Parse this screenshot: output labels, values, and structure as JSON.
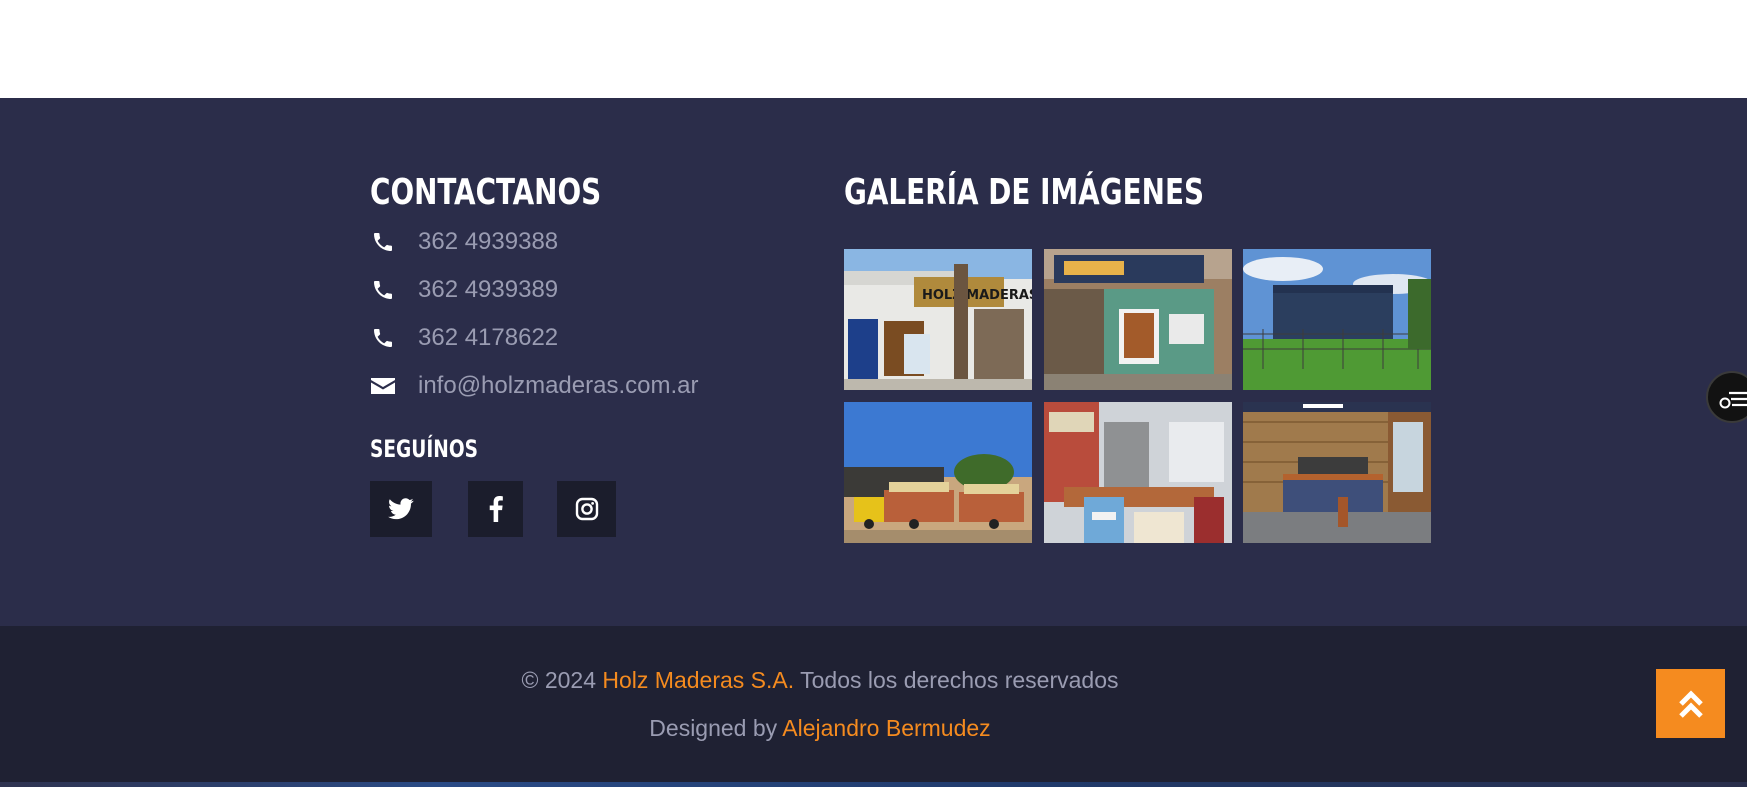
{
  "contact": {
    "heading": "CONTACTANOS",
    "items": [
      {
        "icon": "phone-icon",
        "text": "362 4939388"
      },
      {
        "icon": "phone-icon",
        "text": "362 4939389"
      },
      {
        "icon": "phone-icon",
        "text": "362 4178622"
      },
      {
        "icon": "envelope-icon",
        "text": "info@holzmaderas.com.ar"
      }
    ]
  },
  "follow": {
    "heading": "SEGUÍNOS",
    "networks": [
      "twitter-icon",
      "facebook-icon",
      "instagram-icon"
    ]
  },
  "gallery": {
    "heading": "GALERÍA DE IMÁGENES",
    "sign_text": "HOLZ MADERAS"
  },
  "footer": {
    "copyright_prefix": "© 2024",
    "company": "Holz Maderas S.A.",
    "rights": "Todos los derechos reservados",
    "designed_prefix": "Designed by",
    "designer": "Alejandro Bermudez"
  },
  "colors": {
    "footer_bg": "#2b2d4a",
    "bottom_bg": "#1f2133",
    "accent": "#f58b1f",
    "muted_text": "#9a9cb2",
    "social_bg": "#1b1d2c"
  }
}
